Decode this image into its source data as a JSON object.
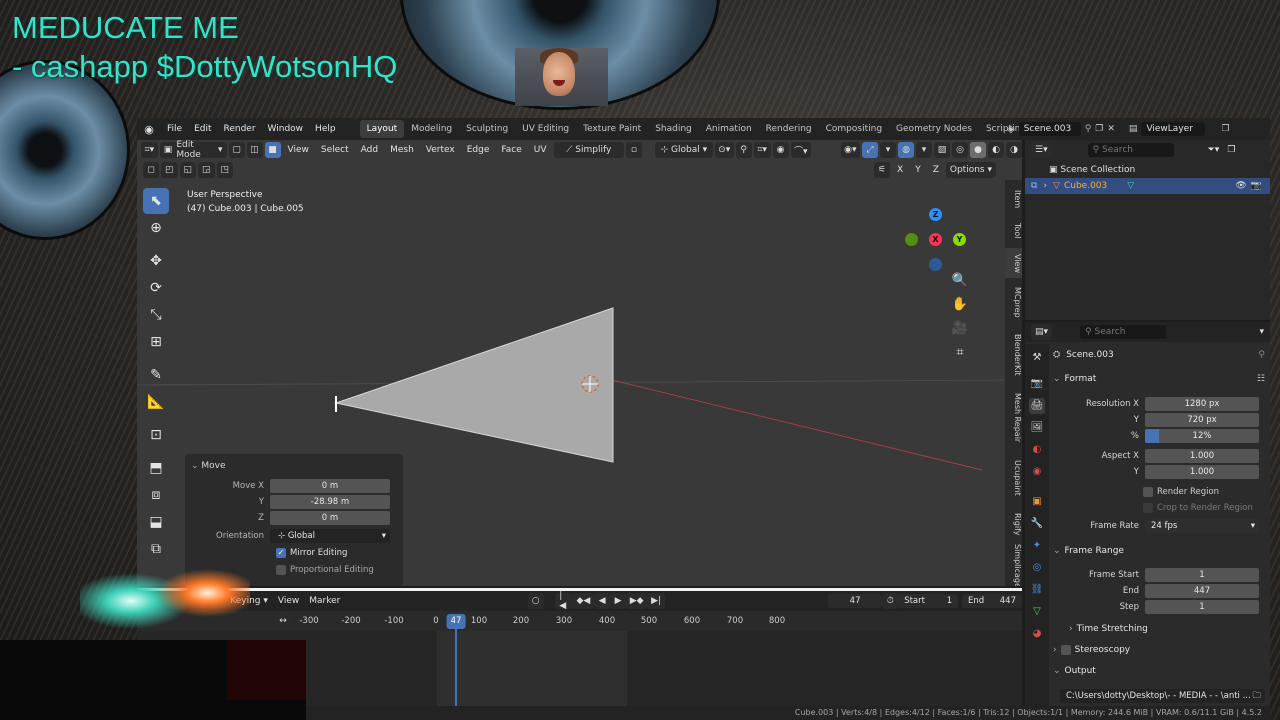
{
  "overlay": {
    "line1": "MEDUCATE ME",
    "line2": "- cashapp $DottyWotsonHQ"
  },
  "topbar": {
    "menus": [
      "File",
      "Edit",
      "Render",
      "Window",
      "Help"
    ],
    "workspaces": [
      "Layout",
      "Modeling",
      "Sculpting",
      "UV Editing",
      "Texture Paint",
      "Shading",
      "Animation",
      "Rendering",
      "Compositing",
      "Geometry Nodes",
      "Scripting"
    ],
    "active_workspace": "Layout",
    "add_tab": "+",
    "scene_name": "Scene.003",
    "view_layer": "ViewLayer"
  },
  "viewport": {
    "mode": "Edit Mode",
    "menus": [
      "View",
      "Select",
      "Add",
      "Mesh",
      "Vertex",
      "Edge",
      "Face",
      "UV"
    ],
    "simplify": "Simplify",
    "orientation": "Global",
    "options": "Options",
    "axis_x": "X",
    "axis_y": "Y",
    "axis_z": "Z",
    "perspective": "User Perspective",
    "object_info": "(47) Cube.003 | Cube.005",
    "side_tabs": [
      "Item",
      "Tool",
      "View",
      "MCprep",
      "BlenderKit",
      "Mesh Repair",
      "Ucupaint",
      "Rigify",
      "Simplicage"
    ],
    "gizmo": {
      "z": "Z",
      "x": "X",
      "y": "Y"
    }
  },
  "operator": {
    "title": "Move",
    "move_x_label": "Move X",
    "move_x": "0 m",
    "y_label": "Y",
    "move_y": "-28.98 m",
    "z_label": "Z",
    "move_z": "0 m",
    "orientation_label": "Orientation",
    "orientation": "Global",
    "mirror": "Mirror Editing",
    "proportional": "Proportional Editing"
  },
  "timeline": {
    "menus": [
      "Keying",
      "View",
      "Marker"
    ],
    "current_frame": "47",
    "start_label": "Start",
    "start": "1",
    "end_label": "End",
    "end": "447",
    "ruler": [
      "-300",
      "-200",
      "-100",
      "0",
      "100",
      "200",
      "300",
      "400",
      "500",
      "600",
      "700",
      "800"
    ]
  },
  "outliner": {
    "search_placeholder": "Search",
    "collection": "Scene Collection",
    "object": "Cube.003"
  },
  "properties": {
    "search_placeholder": "Search",
    "scene": "Scene.003",
    "format_section": "Format",
    "res_x_label": "Resolution X",
    "res_x": "1280 px",
    "res_y_label": "Y",
    "res_y": "720 px",
    "res_pct_label": "%",
    "res_pct": "12%",
    "res_pct_value": 0.12,
    "aspect_x_label": "Aspect X",
    "aspect_x": "1.000",
    "aspect_y_label": "Y",
    "aspect_y": "1.000",
    "render_region": "Render Region",
    "crop_region": "Crop to Render Region",
    "frame_rate_label": "Frame Rate",
    "frame_rate": "24 fps",
    "frame_range_section": "Frame Range",
    "frame_start_label": "Frame Start",
    "frame_start": "1",
    "end_label": "End",
    "end": "447",
    "step_label": "Step",
    "step": "1",
    "time_stretching": "Time Stretching",
    "stereoscopy": "Stereoscopy",
    "output": "Output",
    "filepath": "C:\\Users\\dotty\\Desktop\\- - MEDIA - - \\anti ..."
  },
  "status": {
    "text": "Cube.003 | Verts:4/8 | Edges:4/12 | Faces:1/6 | Tris:12 | Objects:1/1 | Memory: 244.6 MiB | VRAM: 0.6/11.1 GiB | 4.5.2"
  },
  "colors": {
    "overlay_text": "#35e3c9",
    "accent": "#4772b3",
    "x_axis": "#ff3352",
    "y_axis": "#8bdc00",
    "z_axis": "#2890ff"
  }
}
